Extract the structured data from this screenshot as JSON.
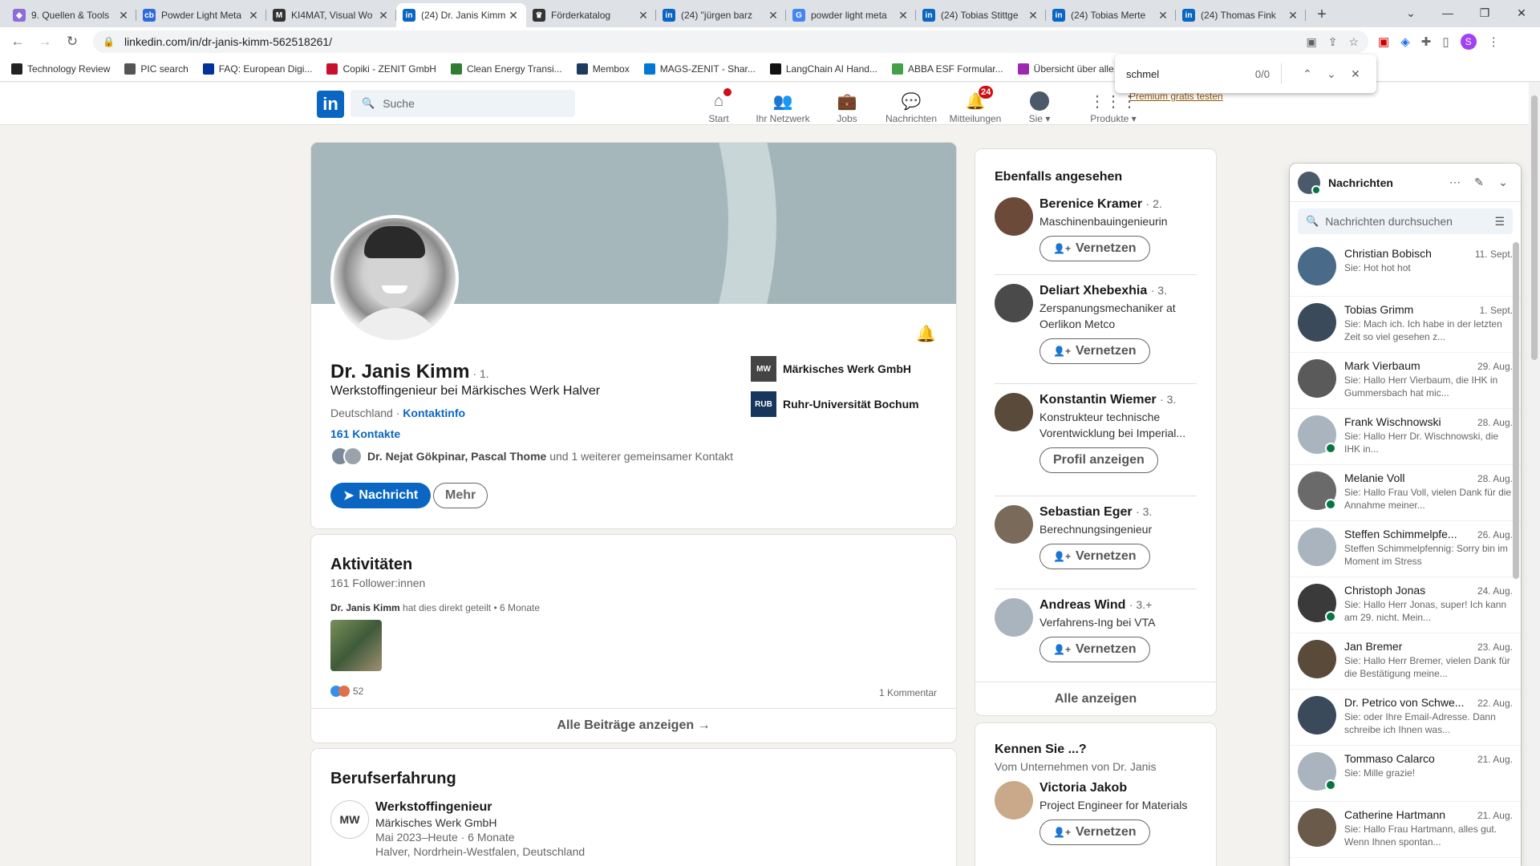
{
  "browser": {
    "tabs": [
      {
        "title": "9. Quellen & Tools",
        "color": "#8e6bd8",
        "glyph": "◆"
      },
      {
        "title": "Powder Light Meta",
        "color": "#2f6bd8",
        "glyph": "cb"
      },
      {
        "title": "KI4MAT, Visual Wo",
        "color": "#333333",
        "glyph": "M"
      },
      {
        "title": "(24) Dr. Janis Kimm",
        "color": "#0a66c2",
        "glyph": "in",
        "active": true
      },
      {
        "title": "Förderkatalog",
        "color": "#333333",
        "glyph": "♛"
      },
      {
        "title": "(24) \"jürgen barz",
        "color": "#0a66c2",
        "glyph": "in"
      },
      {
        "title": "powder light meta",
        "color": "#4285f4",
        "glyph": "G"
      },
      {
        "title": "(24) Tobias Stittge",
        "color": "#0a66c2",
        "glyph": "in"
      },
      {
        "title": "(24) Tobias Merte",
        "color": "#0a66c2",
        "glyph": "in"
      },
      {
        "title": "(24) Thomas Fink",
        "color": "#0a66c2",
        "glyph": "in"
      }
    ],
    "url": "linkedin.com/in/dr-janis-kimm-562518261/",
    "bookmarks": [
      {
        "label": "Technology Review",
        "color": "#222222"
      },
      {
        "label": "PIC search",
        "color": "#555555"
      },
      {
        "label": "FAQ: European Digi...",
        "color": "#003399"
      },
      {
        "label": "Copiki - ZENIT GmbH",
        "color": "#c8102e"
      },
      {
        "label": "Clean Energy Transi...",
        "color": "#2e7d32"
      },
      {
        "label": "Membox",
        "color": "#1e3a5f"
      },
      {
        "label": "MAGS-ZENIT - Shar...",
        "color": "#0078d4"
      },
      {
        "label": "LangChain AI Hand...",
        "color": "#111111"
      },
      {
        "label": "ABBA ESF Formular...",
        "color": "#43a047"
      },
      {
        "label": "Übersicht über alle...",
        "color": "#9c27b0"
      }
    ],
    "find": {
      "query": "schmel",
      "count": "0/0"
    }
  },
  "linkedin": {
    "logo": "in",
    "search_placeholder": "Suche",
    "nav": [
      {
        "label": "Start",
        "icon": "home-icon",
        "glyph": "⌂",
        "dot": true
      },
      {
        "label": "Ihr Netzwerk",
        "icon": "network-icon",
        "glyph": "👥"
      },
      {
        "label": "Jobs",
        "icon": "briefcase-icon",
        "glyph": "💼"
      },
      {
        "label": "Nachrichten",
        "icon": "chat-icon",
        "glyph": "💬"
      },
      {
        "label": "Mitteilungen",
        "icon": "bell-icon",
        "glyph": "🔔",
        "badge": "24"
      },
      {
        "label": "Sie ▾",
        "icon": "me-avatar",
        "glyph": ""
      },
      {
        "label": "Produkte ▾",
        "icon": "grid-icon",
        "glyph": "⋮⋮⋮"
      }
    ],
    "premium": "Premium gratis testen"
  },
  "profile": {
    "name": "Dr. Janis Kimm",
    "degree": "· 1.",
    "headline": "Werkstoffingenieur bei Märkisches Werk Halver",
    "location": "Deutschland ·",
    "contact_info": "Kontaktinfo",
    "connections": "161 Kontakte",
    "mutual_names": "Dr. Nejat Gökpinar, Pascal Thome",
    "mutual_rest": "und 1 weiterer gemeinsamer Kontakt",
    "message_button": "Nachricht",
    "more_button": "Mehr",
    "orgs": [
      {
        "name": "Märkisches Werk GmbH",
        "logo": "MW",
        "color": "#444444"
      },
      {
        "name": "Ruhr-Universität Bochum",
        "logo": "RUB",
        "color": "#17365c"
      }
    ]
  },
  "activity": {
    "title": "Aktivitäten",
    "followers": "161 Follower:innen",
    "shared_by": "Dr. Janis Kimm",
    "shared_text": "hat dies direkt geteilt • 6 Monate",
    "reactions": "52",
    "comments": "1 Kommentar",
    "all_posts": "Alle Beiträge anzeigen →"
  },
  "experience": {
    "title": "Berufserfahrung",
    "items": [
      {
        "role": "Werkstoffingenieur",
        "company": "Märkisches Werk GmbH",
        "dates": "Mai 2023–Heute · 6 Monate",
        "place": "Halver, Nordrhein-Westfalen, Deutschland"
      }
    ]
  },
  "also_viewed": {
    "title": "Ebenfalls angesehen",
    "people": [
      {
        "name": "Berenice Kramer",
        "degree": "· 2.",
        "title": "Maschinenbauingenieurin",
        "button": "Vernetzen",
        "avatar_color": "#6b4a3a"
      },
      {
        "name": "Deliart Xhebexhia",
        "degree": "· 3.",
        "title": "Zerspanungsmechaniker at Oerlikon Metco",
        "button": "Vernetzen",
        "avatar_color": "#4a4a4a"
      },
      {
        "name": "Konstantin Wiemer",
        "degree": "· 3.",
        "title": "Konstrukteur technische Vorentwicklung bei Imperial...",
        "button": "Profil anzeigen",
        "avatar_color": "#5a4a3a"
      },
      {
        "name": "Sebastian Eger",
        "degree": "· 3.",
        "title": "Berechnungsingenieur",
        "button": "Vernetzen",
        "avatar_color": "#7a6a5a"
      },
      {
        "name": "Andreas Wind",
        "degree": "· 3.+",
        "title": "Verfahrens-Ing bei VTA",
        "button": "Vernetzen",
        "avatar_color": "#a9b4be"
      }
    ],
    "show_all": "Alle anzeigen"
  },
  "people_you_may_know": {
    "title": "Kennen Sie ...?",
    "subtitle": "Vom Unternehmen von Dr. Janis",
    "people": [
      {
        "name": "Victoria Jakob",
        "title": "Project Engineer for Materials",
        "button": "Vernetzen",
        "avatar_color": "#c9a98a"
      }
    ]
  },
  "messaging": {
    "title": "Nachrichten",
    "search_placeholder": "Nachrichten durchsuchen",
    "conversations": [
      {
        "name": "Christian Bobisch",
        "date": "11. Sept.",
        "preview": "Sie: Hot hot hot",
        "online": false,
        "avatar_color": "#4a6a8a"
      },
      {
        "name": "Tobias Grimm",
        "date": "1. Sept.",
        "preview": "Sie: Mach ich. Ich habe in der letzten Zeit so viel gesehen z...",
        "online": false,
        "avatar_color": "#3a4a5a"
      },
      {
        "name": "Mark Vierbaum",
        "date": "29. Aug.",
        "preview": "Sie: Hallo Herr Vierbaum, die IHK in Gummersbach hat mic...",
        "online": false,
        "avatar_color": "#5a5a5a"
      },
      {
        "name": "Frank Wischnowski",
        "date": "28. Aug.",
        "preview": "Sie: Hallo Herr Dr. Wischnowski, die IHK in...",
        "online": true,
        "avatar_color": "#a9b4be"
      },
      {
        "name": "Melanie Voll",
        "date": "28. Aug.",
        "preview": "Sie: Hallo Frau Voll, vielen Dank für die Annahme meiner...",
        "online": true,
        "avatar_color": "#6a6a6a"
      },
      {
        "name": "Steffen Schimmelpfe...",
        "date": "26. Aug.",
        "preview": "Steffen Schimmelpfennig: Sorry bin im Moment im Stress",
        "online": false,
        "avatar_color": "#a9b4be"
      },
      {
        "name": "Christoph Jonas",
        "date": "24. Aug.",
        "preview": "Sie: Hallo Herr Jonas, super! Ich kann am 29. nicht. Mein...",
        "online": true,
        "avatar_color": "#3a3a3a"
      },
      {
        "name": "Jan Bremer",
        "date": "23. Aug.",
        "preview": "Sie: Hallo Herr Bremer, vielen Dank für die Bestätigung meine...",
        "online": false,
        "avatar_color": "#5a4a3a"
      },
      {
        "name": "Dr. Petrico von Schwe...",
        "date": "22. Aug.",
        "preview": "Sie: oder Ihre Email-Adresse. Dann schreibe ich Ihnen was...",
        "online": false,
        "avatar_color": "#3a4a5a"
      },
      {
        "name": "Tommaso Calarco",
        "date": "21. Aug.",
        "preview": "Sie: Mille grazie!",
        "online": true,
        "avatar_color": "#a9b4be"
      },
      {
        "name": "Catherine Hartmann",
        "date": "21. Aug.",
        "preview": "Sie: Hallo Frau Hartmann, alles gut. Wenn Ihnen spontan...",
        "online": false,
        "avatar_color": "#6a5a4a"
      }
    ]
  }
}
